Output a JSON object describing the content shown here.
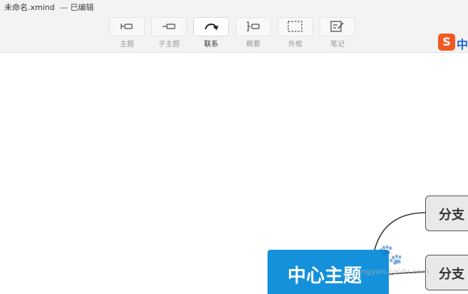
{
  "window": {
    "file_name": "未命名.xmind",
    "status": "— 已编辑"
  },
  "toolbar": {
    "items": [
      {
        "label": "主题",
        "icon": "topic-icon",
        "active": false
      },
      {
        "label": "子主题",
        "icon": "subtopic-icon",
        "active": false
      },
      {
        "label": "联系",
        "icon": "relationship-icon",
        "active": true
      },
      {
        "label": "概要",
        "icon": "summary-icon",
        "active": false
      },
      {
        "label": "外框",
        "icon": "boundary-icon",
        "active": false
      },
      {
        "label": "笔记",
        "icon": "note-icon",
        "active": false
      }
    ]
  },
  "ime": {
    "logo": "S",
    "mode": "中",
    "color": "#f05a22"
  },
  "mindmap": {
    "central_topic": "中心主题",
    "central_color": "#1591dc",
    "branches": [
      {
        "label": "分支"
      },
      {
        "label": "分支"
      }
    ]
  },
  "watermark": {
    "text": "jingyan.baidu.com"
  }
}
